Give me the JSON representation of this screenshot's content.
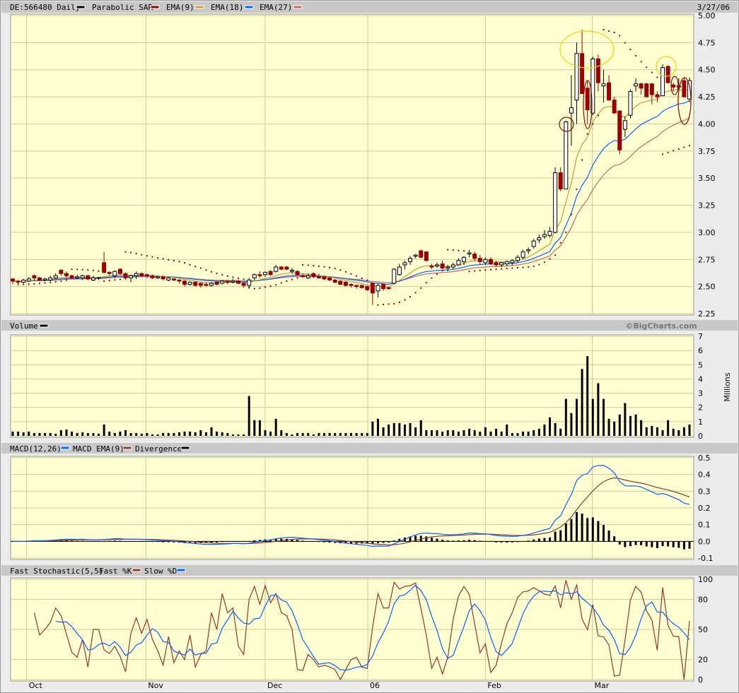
{
  "header": {
    "symbol_label": "DE:566480 Daily",
    "legend": [
      {
        "label": "Parabolic SAR",
        "color": "#990000"
      },
      {
        "label": "EMA(9)",
        "color": "#cc9933"
      },
      {
        "label": "EMA(18)",
        "color": "#0066ff"
      },
      {
        "label": "EMA(27)",
        "color": "#cc6666"
      }
    ],
    "symbol_color": "#000000",
    "date": "3/27/06"
  },
  "volume_panel": {
    "title": "Volume",
    "color": "#000000",
    "brand": "©BigCharts.com",
    "unit": "Millions"
  },
  "macd_panel": {
    "title": "MACD(12,26)",
    "legend": [
      {
        "label": "MACD EMA(9)",
        "color": "#0066ff"
      },
      {
        "label": "Divergence",
        "color": "#993333"
      }
    ],
    "divergence_color": "#000000"
  },
  "stoch_panel": {
    "title": "Fast Stochastic(5,5)",
    "legend": [
      {
        "label": "Fast %K",
        "color": "#993333"
      },
      {
        "label": "Slow %D",
        "color": "#0066ff"
      }
    ]
  },
  "chart_data": [
    {
      "type": "candlestick",
      "title": "DE:566480 Daily",
      "ylim": [
        2.25,
        5.0
      ],
      "yticks": [
        "5.00",
        "4.75",
        "4.50",
        "4.25",
        "4.00",
        "3.75",
        "3.50",
        "3.25",
        "3.00",
        "2.75",
        "2.50",
        "2.25"
      ],
      "xticks": [
        {
          "label": "Oct",
          "bar": 2.6
        },
        {
          "label": "Nov",
          "bar": 24.8
        },
        {
          "label": "Dec",
          "bar": 47
        },
        {
          "label": "06",
          "bar": 66.1
        },
        {
          "label": "Feb",
          "bar": 88
        },
        {
          "label": "Mar",
          "bar": 107.9
        }
      ],
      "ohlc": [
        [
          2.57,
          2.58,
          2.52,
          2.55
        ],
        [
          2.55,
          2.56,
          2.52,
          2.54
        ],
        [
          2.54,
          2.57,
          2.53,
          2.56
        ],
        [
          2.55,
          2.59,
          2.54,
          2.57
        ],
        [
          2.6,
          2.61,
          2.55,
          2.58
        ],
        [
          2.58,
          2.59,
          2.55,
          2.56
        ],
        [
          2.56,
          2.58,
          2.55,
          2.57
        ],
        [
          2.56,
          2.6,
          2.55,
          2.58
        ],
        [
          2.58,
          2.62,
          2.57,
          2.6
        ],
        [
          2.65,
          2.66,
          2.6,
          2.62
        ],
        [
          2.62,
          2.64,
          2.58,
          2.6
        ],
        [
          2.6,
          2.61,
          2.57,
          2.58
        ],
        [
          2.58,
          2.61,
          2.57,
          2.59
        ],
        [
          2.58,
          2.61,
          2.56,
          2.6
        ],
        [
          2.6,
          2.61,
          2.56,
          2.57
        ],
        [
          2.56,
          2.6,
          2.55,
          2.58
        ],
        [
          2.58,
          2.59,
          2.56,
          2.58
        ],
        [
          2.72,
          2.82,
          2.62,
          2.63
        ],
        [
          2.63,
          2.64,
          2.6,
          2.62
        ],
        [
          2.6,
          2.65,
          2.58,
          2.64
        ],
        [
          2.66,
          2.67,
          2.61,
          2.62
        ],
        [
          2.62,
          2.63,
          2.56,
          2.58
        ],
        [
          2.58,
          2.61,
          2.54,
          2.6
        ],
        [
          2.6,
          2.64,
          2.57,
          2.62
        ],
        [
          2.62,
          2.63,
          2.59,
          2.6
        ],
        [
          2.61,
          2.62,
          2.58,
          2.6
        ],
        [
          2.6,
          2.61,
          2.57,
          2.58
        ],
        [
          2.58,
          2.6,
          2.57,
          2.59
        ],
        [
          2.59,
          2.6,
          2.56,
          2.57
        ],
        [
          2.56,
          2.59,
          2.55,
          2.58
        ],
        [
          2.57,
          2.58,
          2.55,
          2.56
        ],
        [
          2.56,
          2.57,
          2.53,
          2.55
        ],
        [
          2.55,
          2.56,
          2.5,
          2.52
        ],
        [
          2.52,
          2.55,
          2.51,
          2.54
        ],
        [
          2.54,
          2.55,
          2.5,
          2.51
        ],
        [
          2.53,
          2.54,
          2.49,
          2.51
        ],
        [
          2.52,
          2.54,
          2.5,
          2.51
        ],
        [
          2.51,
          2.54,
          2.5,
          2.53
        ],
        [
          2.54,
          2.55,
          2.51,
          2.52
        ],
        [
          2.53,
          2.56,
          2.52,
          2.55
        ],
        [
          2.55,
          2.56,
          2.52,
          2.54
        ],
        [
          2.54,
          2.57,
          2.53,
          2.55
        ],
        [
          2.55,
          2.56,
          2.52,
          2.53
        ],
        [
          2.53,
          2.54,
          2.49,
          2.51
        ],
        [
          2.51,
          2.58,
          2.48,
          2.56
        ],
        [
          2.58,
          2.62,
          2.56,
          2.61
        ],
        [
          2.61,
          2.64,
          2.58,
          2.6
        ],
        [
          2.61,
          2.64,
          2.59,
          2.63
        ],
        [
          2.64,
          2.65,
          2.6,
          2.61
        ],
        [
          2.64,
          2.7,
          2.63,
          2.68
        ],
        [
          2.68,
          2.69,
          2.65,
          2.66
        ],
        [
          2.68,
          2.69,
          2.65,
          2.66
        ],
        [
          2.64,
          2.67,
          2.62,
          2.65
        ],
        [
          2.64,
          2.65,
          2.6,
          2.61
        ],
        [
          2.6,
          2.62,
          2.58,
          2.59
        ],
        [
          2.58,
          2.62,
          2.57,
          2.6
        ],
        [
          2.62,
          2.63,
          2.58,
          2.59
        ],
        [
          2.59,
          2.62,
          2.57,
          2.58
        ],
        [
          2.59,
          2.6,
          2.56,
          2.57
        ],
        [
          2.58,
          2.59,
          2.55,
          2.56
        ],
        [
          2.56,
          2.57,
          2.53,
          2.54
        ],
        [
          2.55,
          2.56,
          2.52,
          2.52
        ],
        [
          2.54,
          2.55,
          2.5,
          2.51
        ],
        [
          2.52,
          2.53,
          2.49,
          2.51
        ],
        [
          2.51,
          2.52,
          2.48,
          2.5
        ],
        [
          2.51,
          2.52,
          2.48,
          2.49
        ],
        [
          2.5,
          2.51,
          2.46,
          2.47
        ],
        [
          2.53,
          2.54,
          2.33,
          2.44
        ],
        [
          2.46,
          2.53,
          2.4,
          2.51
        ],
        [
          2.52,
          2.53,
          2.46,
          2.48
        ],
        [
          2.49,
          2.5,
          2.47,
          2.48
        ],
        [
          2.53,
          2.67,
          2.52,
          2.66
        ],
        [
          2.61,
          2.71,
          2.6,
          2.68
        ],
        [
          2.7,
          2.74,
          2.66,
          2.72
        ],
        [
          2.73,
          2.78,
          2.7,
          2.76
        ],
        [
          2.78,
          2.8,
          2.76,
          2.79
        ],
        [
          2.83,
          2.84,
          2.76,
          2.77
        ],
        [
          2.82,
          2.82,
          2.73,
          2.74
        ],
        [
          2.69,
          2.71,
          2.66,
          2.68
        ],
        [
          2.69,
          2.72,
          2.67,
          2.7
        ],
        [
          2.71,
          2.74,
          2.66,
          2.67
        ],
        [
          2.67,
          2.7,
          2.64,
          2.68
        ],
        [
          2.68,
          2.72,
          2.66,
          2.7
        ],
        [
          2.7,
          2.76,
          2.69,
          2.74
        ],
        [
          2.73,
          2.78,
          2.7,
          2.77
        ],
        [
          2.8,
          2.84,
          2.77,
          2.81
        ],
        [
          2.8,
          2.82,
          2.74,
          2.76
        ],
        [
          2.76,
          2.79,
          2.7,
          2.73
        ],
        [
          2.72,
          2.77,
          2.7,
          2.75
        ],
        [
          2.75,
          2.77,
          2.7,
          2.71
        ],
        [
          2.72,
          2.74,
          2.68,
          2.7
        ],
        [
          2.7,
          2.73,
          2.68,
          2.72
        ],
        [
          2.71,
          2.74,
          2.69,
          2.73
        ],
        [
          2.72,
          2.75,
          2.7,
          2.74
        ],
        [
          2.74,
          2.79,
          2.72,
          2.77
        ],
        [
          2.77,
          2.84,
          2.75,
          2.82
        ],
        [
          2.83,
          2.86,
          2.8,
          2.84
        ],
        [
          2.87,
          2.94,
          2.85,
          2.92
        ],
        [
          2.93,
          2.98,
          2.9,
          2.95
        ],
        [
          2.96,
          3.02,
          2.94,
          2.98
        ],
        [
          2.97,
          3.05,
          2.95,
          3.01
        ],
        [
          3.0,
          3.6,
          2.99,
          3.55
        ],
        [
          3.55,
          3.6,
          3.38,
          3.4
        ],
        [
          3.4,
          4.03,
          3.4,
          4.02
        ],
        [
          4.1,
          4.45,
          3.8,
          4.15
        ],
        [
          4.22,
          4.75,
          4.0,
          4.65
        ],
        [
          4.65,
          4.87,
          4.28,
          4.28
        ],
        [
          4.33,
          4.4,
          4.0,
          4.13
        ],
        [
          4.1,
          4.62,
          4.08,
          4.6
        ],
        [
          4.6,
          4.64,
          4.3,
          4.38
        ],
        [
          4.35,
          4.5,
          4.2,
          4.37
        ],
        [
          4.38,
          4.45,
          4.22,
          4.22
        ],
        [
          4.22,
          4.25,
          4.1,
          4.1
        ],
        [
          4.12,
          4.12,
          3.72,
          3.76
        ],
        [
          3.95,
          4.07,
          3.88,
          4.03
        ],
        [
          4.08,
          4.32,
          4.05,
          4.3
        ],
        [
          4.35,
          4.42,
          4.3,
          4.37
        ],
        [
          4.37,
          4.38,
          4.27,
          4.33
        ],
        [
          4.37,
          4.38,
          4.26,
          4.25
        ],
        [
          4.37,
          4.38,
          4.18,
          4.27
        ],
        [
          4.27,
          4.3,
          4.2,
          4.25
        ],
        [
          4.26,
          4.55,
          4.26,
          4.52
        ],
        [
          4.53,
          4.54,
          4.38,
          4.38
        ],
        [
          4.36,
          4.38,
          4.3,
          4.34
        ],
        [
          4.34,
          4.42,
          4.3,
          4.35
        ],
        [
          4.4,
          4.42,
          4.25,
          4.25
        ],
        [
          4.23,
          4.43,
          4.2,
          4.4
        ]
      ]
    },
    {
      "type": "bar",
      "title": "Volume",
      "ylabel": "Millions",
      "ylim": [
        0,
        7
      ],
      "yticks": [
        "7",
        "6",
        "5",
        "4",
        "3",
        "2",
        "1",
        "0"
      ],
      "values": [
        0.3,
        0.3,
        0.25,
        0.3,
        0.2,
        0.2,
        0.2,
        0.2,
        0.15,
        0.4,
        0.45,
        0.3,
        0.2,
        0.25,
        0.2,
        0.2,
        0.15,
        0.8,
        0.3,
        0.2,
        0.3,
        0.4,
        0.2,
        0.2,
        0.15,
        0.2,
        0.1,
        0.1,
        0.2,
        0.2,
        0.2,
        0.25,
        0.3,
        0.3,
        0.25,
        0.4,
        0.25,
        0.6,
        0.3,
        0.25,
        0.2,
        0.1,
        0.1,
        0.1,
        2.8,
        1.1,
        1.1,
        0.4,
        0.3,
        1.2,
        0.4,
        0.2,
        0.1,
        0.2,
        0.2,
        0.2,
        0.1,
        0.2,
        0.2,
        0.2,
        0.2,
        0.2,
        0.2,
        0.2,
        0.2,
        0.2,
        0.2,
        1.0,
        1.2,
        0.6,
        0.8,
        0.9,
        0.9,
        0.8,
        0.9,
        0.6,
        1.1,
        0.4,
        0.4,
        0.4,
        0.3,
        0.4,
        0.4,
        0.3,
        0.4,
        0.5,
        0.4,
        0.3,
        0.6,
        0.3,
        0.5,
        0.3,
        0.8,
        0.2,
        0.2,
        0.3,
        0.3,
        0.4,
        0.5,
        0.8,
        1.3,
        0.9,
        0.5,
        2.6,
        1.6,
        2.6,
        4.7,
        5.6,
        2.6,
        3.7,
        2.6,
        1.2,
        1.0,
        1.5,
        2.3,
        1.4,
        1.5,
        1.1,
        0.6,
        0.7,
        0.6,
        0.4,
        1.1,
        0.5,
        0.4,
        0.6,
        0.8
      ]
    },
    {
      "type": "line",
      "title": "MACD(12,26)",
      "ylim": [
        -0.1,
        0.5
      ],
      "yticks": [
        "0.5",
        "0.4",
        "0.3",
        "0.2",
        "0.1",
        "0.0",
        "-0.1"
      ]
    },
    {
      "type": "line",
      "title": "Fast Stochastic(5,5)",
      "ylim": [
        0,
        100
      ],
      "yticks": [
        "100",
        "80",
        "50",
        "20",
        "0"
      ]
    }
  ]
}
